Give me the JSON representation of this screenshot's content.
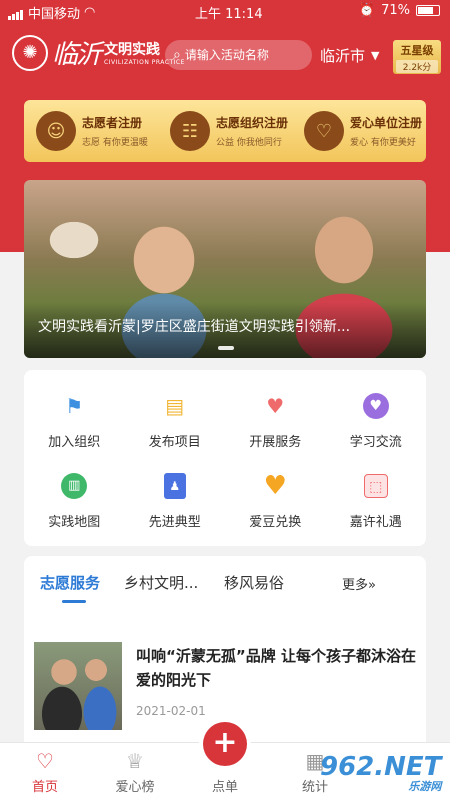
{
  "status": {
    "carrier": "中国移动",
    "time": "上午 11:14",
    "battery": "71%"
  },
  "header": {
    "logo_city": "临沂",
    "logo_brand": "文明实践",
    "logo_brand_en": "CIVILIZATION PRACTICE",
    "search_placeholder": "请输入活动名称",
    "city": "临沂市",
    "level": "五星级",
    "points": "2.2k分"
  },
  "registrations": [
    {
      "title": "志愿者注册",
      "subtitle": "志愿  有你更温暖",
      "icon": "person-icon"
    },
    {
      "title": "志愿组织注册",
      "subtitle": "公益  你我他同行",
      "icon": "group-icon"
    },
    {
      "title": "爱心单位注册",
      "subtitle": "爱心  有你更美好",
      "icon": "heart-icon"
    }
  ],
  "banner": {
    "caption": "文明实践看沂蒙|罗庄区盛庄街道文明实践引领新..."
  },
  "grid": [
    {
      "label": "加入组织",
      "icon": "flag-icon",
      "color": "#3d8fe0"
    },
    {
      "label": "发布项目",
      "icon": "document-icon",
      "color": "#f2b634"
    },
    {
      "label": "开展服务",
      "icon": "hands-heart-icon",
      "color": "#ef6a6a"
    },
    {
      "label": "学习交流",
      "icon": "heart-badge-icon",
      "color": "#9b6ee0"
    },
    {
      "label": "实践地图",
      "icon": "map-icon",
      "color": "#3fb86a"
    },
    {
      "label": "先进典型",
      "icon": "award-icon",
      "color": "#4a72e0"
    },
    {
      "label": "爱豆兑换",
      "icon": "heart-icon",
      "color": "#f5a623"
    },
    {
      "label": "嘉许礼遇",
      "icon": "gift-icon",
      "color": "#ef6a6a"
    }
  ],
  "news": {
    "tabs": [
      "志愿服务",
      "乡村文明...",
      "移风易俗"
    ],
    "more": "更多»",
    "article": {
      "title": "叫响“沂蒙无孤”品牌 让每个孩子都沐浴在爱的阳光下",
      "date": "2021-02-01"
    }
  },
  "nav": [
    {
      "label": "首页",
      "icon": "heart-home-icon"
    },
    {
      "label": "爱心榜",
      "icon": "crown-icon"
    },
    {
      "label": "点单",
      "icon": "plus-icon"
    },
    {
      "label": "统计",
      "icon": "chart-icon"
    }
  ],
  "watermark": {
    "brand": "962.NET",
    "sub": "乐游网"
  }
}
